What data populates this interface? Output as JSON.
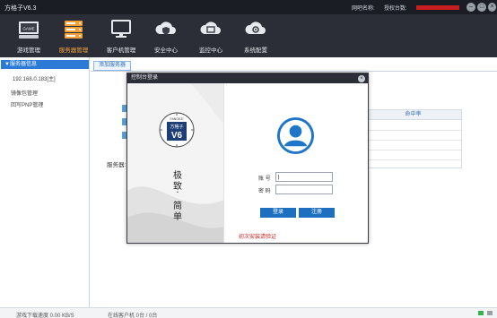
{
  "app": {
    "title": "方格子V6.3",
    "license_name_label": "网吧名称:",
    "license_count_label": "授权台数:",
    "license_name_value": "",
    "license_count_value": "",
    "window_buttons": [
      "minimize-icon",
      "restore-icon",
      "close-icon"
    ]
  },
  "toolbar": {
    "items": [
      {
        "label": "游戏管理",
        "icon": "game-icon",
        "active": false
      },
      {
        "label": "服务器管理",
        "icon": "server-icon",
        "active": true
      },
      {
        "label": "客户机管理",
        "icon": "client-pc-icon",
        "active": false
      },
      {
        "label": "安全中心",
        "icon": "security-cloud-icon",
        "active": false
      },
      {
        "label": "监控中心",
        "icon": "monitor-cloud-icon",
        "active": false
      },
      {
        "label": "系统配置",
        "icon": "settings-cloud-icon",
        "active": false
      }
    ],
    "active_color": "#f3a23a"
  },
  "sidebar": {
    "header": "▼服务器信息",
    "server_ip": "192.168.0.183[主]",
    "items": [
      "镜像包管理",
      "回写PNP管理"
    ]
  },
  "main": {
    "tab_label": "添加服务器",
    "server_label": "服务器:",
    "table_header": "命中率"
  },
  "modal": {
    "title": "控制台登录",
    "logo_top": "FANGEZI",
    "logo_brand": "方格子",
    "logo_version": "V6",
    "slogan": [
      "极",
      "致",
      "·",
      "简",
      "单"
    ],
    "account_label": "账 号",
    "password_label": "密 码",
    "account_value": "|",
    "password_value": "",
    "login_button": "登录",
    "register_button": "注册",
    "verify_text": "初次安装请验证",
    "accent": "#1d6fc0"
  },
  "status": {
    "download_speed": "游戏下载速度 0.00 KB/S",
    "online_clients": "在线客户机  0台 / 0台"
  }
}
